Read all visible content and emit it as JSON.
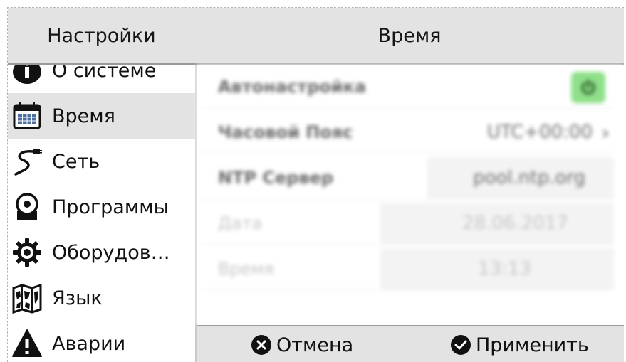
{
  "header": {
    "left_title": "Настройки",
    "right_title": "Время"
  },
  "sidebar": {
    "items": [
      {
        "label": "О системе",
        "icon": "info-icon"
      },
      {
        "label": "Время",
        "icon": "calendar-icon",
        "selected": true
      },
      {
        "label": "Сеть",
        "icon": "network-cable-icon"
      },
      {
        "label": "Программы",
        "icon": "software-icon"
      },
      {
        "label": "Оборудов…",
        "icon": "gear-icon"
      },
      {
        "label": "Язык",
        "icon": "map-icon"
      },
      {
        "label": "Аварии",
        "icon": "warning-icon"
      }
    ]
  },
  "panel": {
    "auto_label": "Автонастройка",
    "timezone_label": "Часовой Пояс",
    "timezone_value": "UTC+00:00",
    "ntp_label": "NTP Сервер",
    "ntp_value": "pool.ntp.org",
    "date_label": "Дата",
    "date_value": "28.06.2017",
    "time_label": "Время",
    "time_value": "13:13"
  },
  "footer": {
    "cancel_label": "Отмена",
    "apply_label": "Применить"
  },
  "colors": {
    "header_bg": "#e3e3e3",
    "selected_bg": "#e3e3e3",
    "toggle_on": "#8fe08a"
  }
}
